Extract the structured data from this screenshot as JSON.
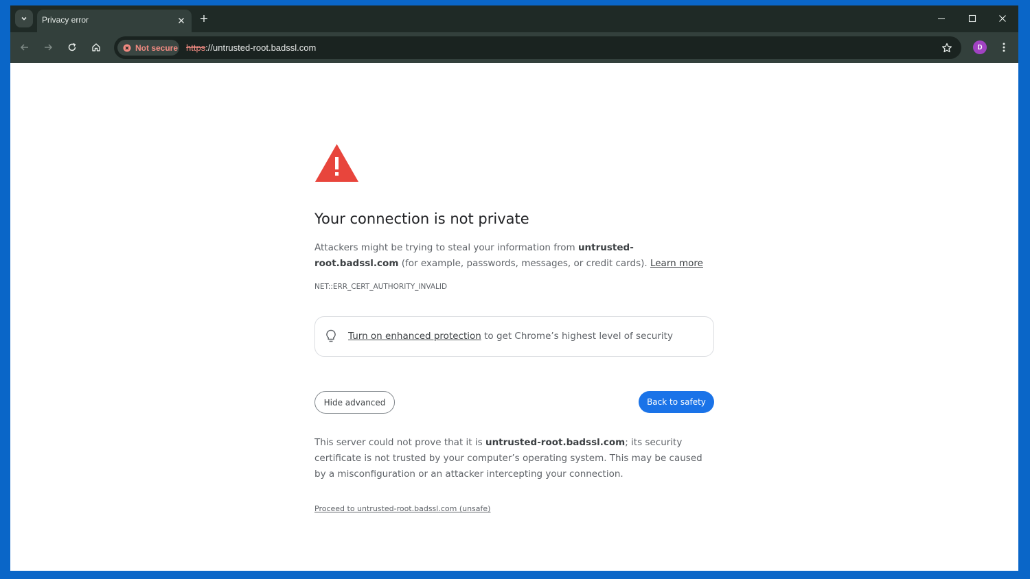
{
  "browser": {
    "tab": {
      "title": "Privacy error"
    },
    "omnibox": {
      "security_chip": "Not secure",
      "url_scheme": "https",
      "url_rest": "://untrusted-root.badssl.com"
    },
    "profile_initial": "D"
  },
  "page": {
    "heading": "Your connection is not private",
    "explanation_prefix": "Attackers might be trying to steal your information from ",
    "domain": "untrusted-root.badssl.com",
    "explanation_suffix": " (for example, passwords, messages, or credit cards). ",
    "learn_more": "Learn more",
    "error_code": "NET::ERR_CERT_AUTHORITY_INVALID",
    "promo_link": "Turn on enhanced protection",
    "promo_text": " to get Chrome’s highest level of security",
    "hide_advanced": "Hide advanced",
    "back_to_safety": "Back to safety",
    "details_prefix": "This server could not prove that it is ",
    "details_domain": "untrusted-root.badssl.com",
    "details_suffix": "; its security certificate is not trusted by your computer’s operating system. This may be caused by a misconfiguration or an attacker intercepting your connection.",
    "proceed_link": "Proceed to untrusted-root.badssl.com (unsafe)"
  },
  "colors": {
    "warning_red": "#e8453c",
    "primary_blue": "#1a73e8",
    "not_secure_red": "#f28b82",
    "avatar_purple": "#a142c2"
  },
  "icons": [
    "tab-search-icon",
    "close-icon",
    "plus-icon",
    "minimize-icon",
    "maximize-icon",
    "back-icon",
    "forward-icon",
    "reload-icon",
    "home-icon",
    "not-secure-icon",
    "star-icon",
    "more-menu-icon",
    "warning-triangle-icon",
    "lightbulb-icon"
  ]
}
